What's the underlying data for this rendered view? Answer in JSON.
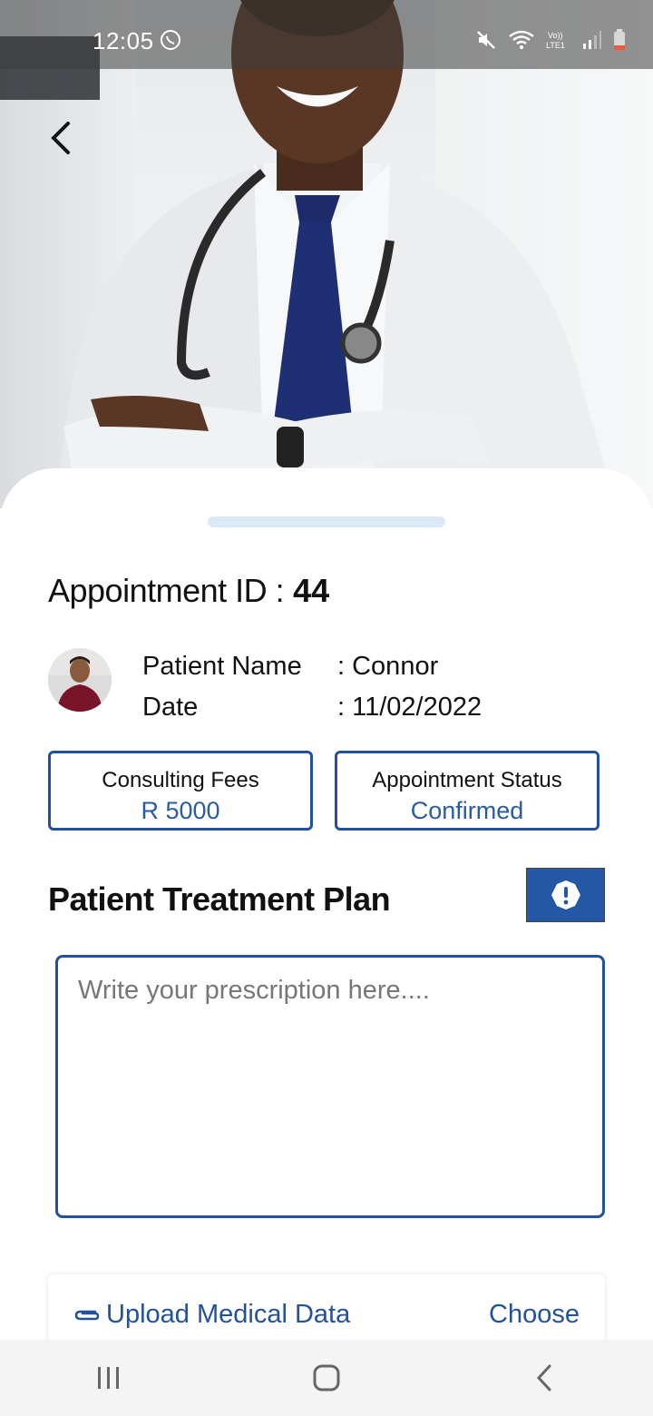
{
  "status_bar": {
    "time": "12:05",
    "icons": [
      "whatsapp-icon",
      "mute-icon",
      "wifi-icon",
      "volte-icon",
      "signal-icon",
      "battery-icon"
    ]
  },
  "hero": {
    "image": "doctor-photo"
  },
  "appointment": {
    "title_label": "Appointment ID :",
    "id": "44",
    "patient_label": "Patient Name",
    "patient_value": ": Connor",
    "date_label": "Date",
    "date_value": ": 11/02/2022"
  },
  "cards": {
    "fees_label": "Consulting Fees",
    "fees_value": "R 5000",
    "status_label": "Appointment Status",
    "status_value": "Confirmed"
  },
  "treatment": {
    "title": "Patient Treatment Plan",
    "placeholder": "Write your prescription here...."
  },
  "upload": {
    "label": "Upload Medical Data",
    "action": "Choose"
  },
  "colors": {
    "accent": "#23529a",
    "accent_light": "#2a5ba4",
    "handle": "#dbe9f7"
  }
}
